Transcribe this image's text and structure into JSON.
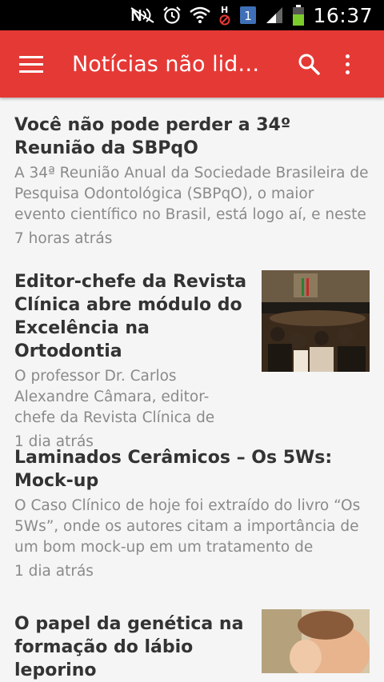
{
  "status_bar": {
    "time": "16:37",
    "notification_badge": "1",
    "icons": [
      "nfc-icon",
      "alarm-icon",
      "wifi-icon",
      "no-hd-icon",
      "sim-badge-icon",
      "signal-icon",
      "battery-icon"
    ]
  },
  "app_bar": {
    "title": "Notícias não lida...",
    "color": "#e53935"
  },
  "articles": [
    {
      "title": "Você não pode perder a 34º Reunião da SBPqO",
      "excerpt": "A 34ª Reunião Anual da Sociedade Brasileira de Pesquisa Odontológica (SBPqO), o maior evento científico no Brasil, está logo aí, e neste",
      "time": "7 horas atrás"
    },
    {
      "title": "Editor-chefe da Revista Clínica abre módulo do Excelência na Ortodontia",
      "excerpt": "O professor Dr. Carlos Alexandre Câmara, editor-chefe da Revista Clínica de",
      "time": "1 dia atrás"
    },
    {
      "title": "Laminados Cerâmicos – Os 5Ws: Mock-up",
      "excerpt": "O Caso Clínico de hoje foi extraído do livro “Os 5Ws”, onde os autores citam a importância de um bom mock-up em um tratamento de",
      "time": "1 dia atrás"
    },
    {
      "title": "O papel da genética na formação do lábio leporino",
      "excerpt": "",
      "time": ""
    }
  ]
}
